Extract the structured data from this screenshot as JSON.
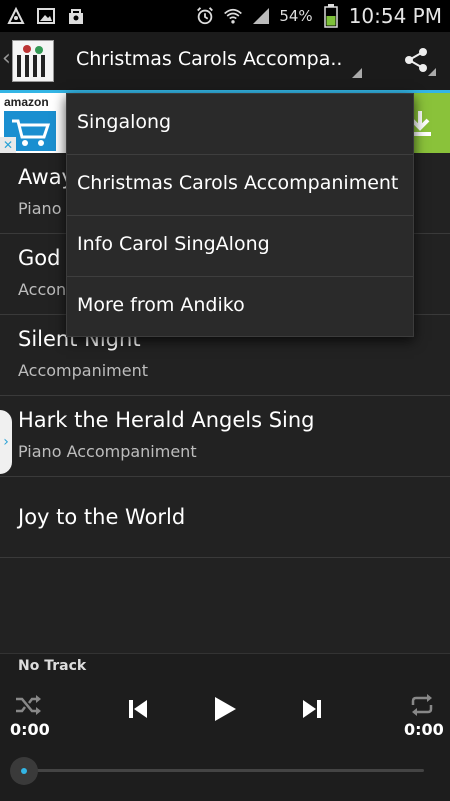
{
  "status_bar": {
    "battery_percent": "54%",
    "time": "10:54 PM",
    "icons": [
      "notification-icon",
      "image-icon",
      "shopping-bag-icon",
      "alarm-icon",
      "wifi-icon",
      "signal-icon",
      "battery-icon"
    ]
  },
  "action_bar": {
    "title": "Christmas Carols Accompa..",
    "share_icon": "share-icon"
  },
  "ad": {
    "brand": "amazon",
    "close_label": "✕",
    "download_icon": "download-icon"
  },
  "dropdown_menu": {
    "items": [
      {
        "label": "Singalong"
      },
      {
        "label": "Christmas Carols Accompaniment"
      },
      {
        "label": "Info Carol SingAlong"
      },
      {
        "label": "More from Andiko"
      }
    ]
  },
  "tracks": [
    {
      "title": "Away",
      "subtitle": "Piano"
    },
    {
      "title": "God",
      "subtitle": "Accon"
    },
    {
      "title": "Silent Night",
      "subtitle": "Accompaniment"
    },
    {
      "title": "Hark the Herald Angels Sing",
      "subtitle": "Piano Accompaniment"
    },
    {
      "title": "Joy to the World",
      "subtitle": ""
    }
  ],
  "player": {
    "track_label": "No Track",
    "elapsed": "0:00",
    "duration": "0:00",
    "progress": 0,
    "accent_color": "#33b5e5"
  },
  "side_tab": {
    "label": "›"
  }
}
